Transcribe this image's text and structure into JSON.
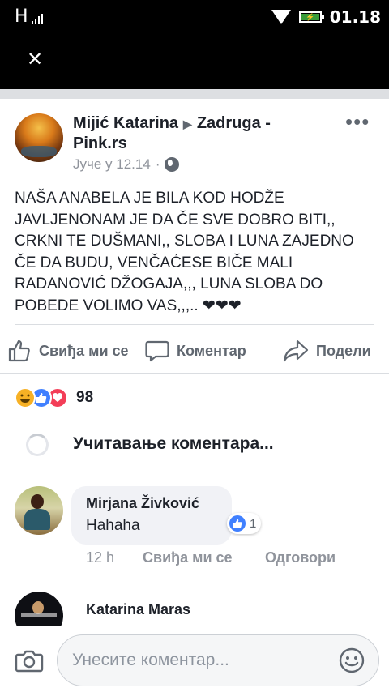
{
  "status_bar": {
    "network": "H",
    "time": "01.18",
    "battery_icon": "battery-charging-icon",
    "wifi_icon": "wifi-icon"
  },
  "top_bar": {
    "close_icon": "close-icon"
  },
  "post": {
    "author": "Mijić Katarina",
    "target": "Zadruga - Pink.rs",
    "timestamp": "Јуче у 12.14",
    "privacy_icon": "globe-icon",
    "body": "NAŠA ANABELA JE BILA KOD HODŽE JAVLJENONAM JE DA ČE SVE DOBRO BITI,, CRKNI TE DUŠMANI,, SLOBA I LUNA ZAJEDNO ČE DA BUDU, VENČAĆESE BIČE MALI RADANOVIĆ DŽOGAJA,,, LUNA SLOBA DO POBEDE VOLIMO VAS,,,.. ❤❤❤"
  },
  "actions": {
    "like": "Свиђа ми се",
    "comment": "Коментар",
    "share": "Подели"
  },
  "reactions": {
    "types": [
      "haha",
      "like",
      "love"
    ],
    "count": "98"
  },
  "loading": {
    "text": "Учитавање коментара..."
  },
  "comments": [
    {
      "author": "Mirjana Živković",
      "text": "Hahaha",
      "reactions_count": "1",
      "time": "12 h",
      "like_label": "Свиђа ми се",
      "reply_label": "Одговори"
    },
    {
      "author": "Katarina Maras"
    }
  ],
  "composer": {
    "placeholder": "Унесите коментар...",
    "camera_icon": "camera-icon",
    "emoji_icon": "emoji-icon"
  }
}
